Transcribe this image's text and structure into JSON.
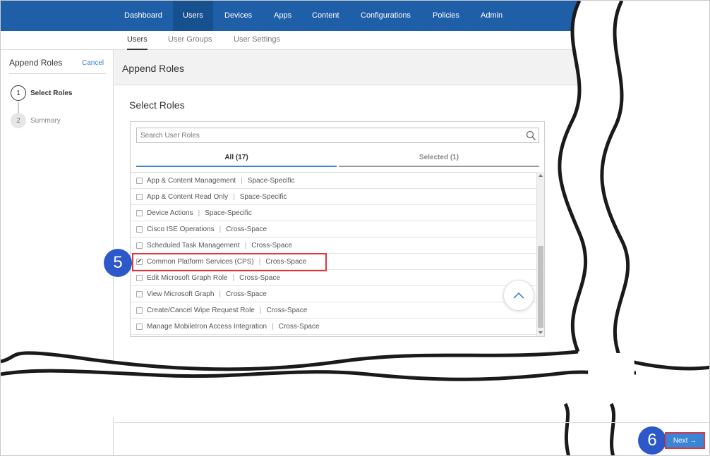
{
  "nav": {
    "items": [
      "Dashboard",
      "Users",
      "Devices",
      "Apps",
      "Content",
      "Configurations",
      "Policies",
      "Admin"
    ],
    "active": "Users"
  },
  "subnav": {
    "items": [
      "Users",
      "User Groups",
      "User Settings"
    ],
    "active": "Users"
  },
  "wizard": {
    "title": "Append Roles",
    "cancel": "Cancel",
    "steps": [
      {
        "num": "1",
        "label": "Select Roles"
      },
      {
        "num": "2",
        "label": "Summary"
      }
    ]
  },
  "main": {
    "header": "Append Roles",
    "section_title": "Select Roles",
    "search_placeholder": "Search User Roles",
    "tabs": {
      "all": "All (17)",
      "selected": "Selected (1)"
    },
    "roles": [
      {
        "name": "App & Content Management",
        "scope": "Space-Specific",
        "checked": false
      },
      {
        "name": "App & Content Read Only",
        "scope": "Space-Specific",
        "checked": false
      },
      {
        "name": "Device Actions",
        "scope": "Space-Specific",
        "checked": false
      },
      {
        "name": "Cisco ISE Operations",
        "scope": "Cross-Space",
        "checked": false
      },
      {
        "name": "Scheduled Task Management",
        "scope": "Cross-Space",
        "checked": false
      },
      {
        "name": "Common Platform Services (CPS)",
        "scope": "Cross-Space",
        "checked": true
      },
      {
        "name": "Edit Microsoft Graph Role",
        "scope": "Cross-Space",
        "checked": false
      },
      {
        "name": "View Microsoft Graph",
        "scope": "Cross-Space",
        "checked": false
      },
      {
        "name": "Create/Cancel Wipe Request Role",
        "scope": "Cross-Space",
        "checked": false
      },
      {
        "name": "Manage MobileIron Access Integration",
        "scope": "Cross-Space",
        "checked": false
      }
    ],
    "separator": "|"
  },
  "callouts": {
    "step5": "5",
    "step6": "6"
  },
  "footer": {
    "next_label": "Next →"
  },
  "colors": {
    "nav_bg": "#1f5fa8",
    "accent": "#3a85d6",
    "callout": "#2d58c9",
    "highlight": "#e0363c"
  }
}
